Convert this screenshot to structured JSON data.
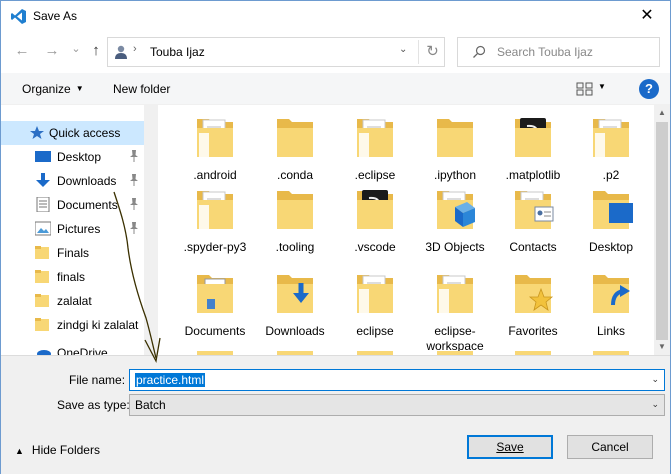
{
  "window": {
    "title": "Save As",
    "close_glyph": "✕",
    "app_icon": "vscode-icon"
  },
  "nav": {
    "back_glyph": "←",
    "forward_glyph": "→",
    "recent_glyph": "⌄",
    "up_glyph": "↑",
    "address_sep": "›",
    "address_text": "Touba Ijaz",
    "address_dd": "⌄",
    "refresh_glyph": "↻",
    "search_placeholder": "Search Touba Ijaz"
  },
  "toolbar": {
    "organize": "Organize",
    "new_folder": "New folder",
    "help": "?",
    "caret": "▼"
  },
  "sidebar": {
    "items": [
      {
        "label": "Quick access",
        "icon": "star-icon",
        "selected": true,
        "pinned": false
      },
      {
        "label": "Desktop",
        "icon": "desktop-icon",
        "pinned": true
      },
      {
        "label": "Downloads",
        "icon": "download-icon",
        "pinned": true
      },
      {
        "label": "Documents",
        "icon": "documents-icon",
        "pinned": true
      },
      {
        "label": "Pictures",
        "icon": "pictures-icon",
        "pinned": true
      },
      {
        "label": "Finals",
        "icon": "folder-icon",
        "pinned": false
      },
      {
        "label": "finals",
        "icon": "folder-icon",
        "pinned": false
      },
      {
        "label": "zalalat",
        "icon": "folder-icon",
        "pinned": false
      },
      {
        "label": "zindgi ki zalalat",
        "icon": "folder-icon",
        "pinned": false
      },
      {
        "label": "OneDrive",
        "icon": "onedrive-icon",
        "pinned": false
      }
    ]
  },
  "files": {
    "row1": [
      {
        "label": ".android",
        "icon": "folder-doc"
      },
      {
        "label": ".conda",
        "icon": "folder"
      },
      {
        "label": ".eclipse",
        "icon": "folder-doc"
      },
      {
        "label": ".ipython",
        "icon": "folder"
      },
      {
        "label": ".matplotlib",
        "icon": "folder-black"
      },
      {
        "label": ".p2",
        "icon": "folder-doc"
      }
    ],
    "row2": [
      {
        "label": ".spyder-py3",
        "icon": "folder-doc"
      },
      {
        "label": ".tooling",
        "icon": "folder"
      },
      {
        "label": ".vscode",
        "icon": "folder-black"
      },
      {
        "label": "3D Objects",
        "icon": "folder-3d"
      },
      {
        "label": "Contacts",
        "icon": "folder-contacts"
      },
      {
        "label": "Desktop",
        "icon": "folder-desktop"
      }
    ],
    "row3": [
      {
        "label": "Documents",
        "icon": "folder-documents"
      },
      {
        "label": "Downloads",
        "icon": "folder-downloads"
      },
      {
        "label": "eclipse",
        "icon": "folder-doc"
      },
      {
        "label": "eclipse-workspace",
        "icon": "folder-doc"
      },
      {
        "label": "Favorites",
        "icon": "folder-star"
      },
      {
        "label": "Links",
        "icon": "folder-links"
      }
    ]
  },
  "form": {
    "file_name_label": "File name:",
    "file_name_value": "practice.html",
    "save_type_label": "Save as type:",
    "save_type_value": "Batch",
    "dd": "⌄"
  },
  "footer": {
    "hide_folders": "Hide Folders",
    "hide_caret": "▲",
    "save": "Save",
    "cancel": "Cancel"
  },
  "colors": {
    "accent": "#0078d7",
    "folder": "#f8d775",
    "folder_dark": "#e8b94a",
    "selection": "#cce8ff"
  }
}
